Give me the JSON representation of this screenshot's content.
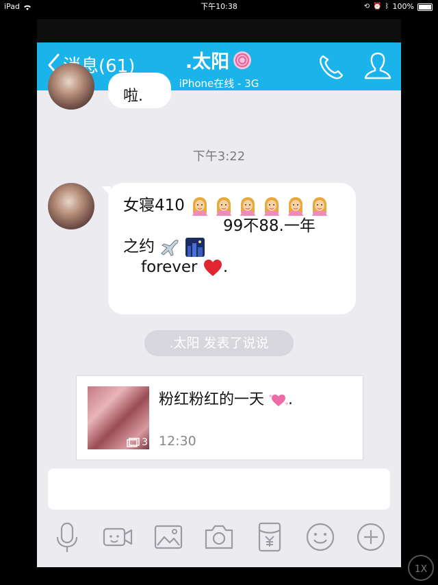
{
  "status_bar": {
    "device": "iPad",
    "time": "下午10:38",
    "battery": "100%"
  },
  "nav": {
    "back_label": "消息(61)",
    "title": ".太阳",
    "subtitle": "iPhone在线 - 3G"
  },
  "top_bubble_text": "啦.",
  "timestamp": "下午3:22",
  "message": {
    "line1": "女寝410",
    "line2": "99不88.一年",
    "line3": "之约",
    "line4": "forever",
    "line4_end": "."
  },
  "system_note": ".太阳 发表了说说",
  "shuoshuo_card": {
    "text": "粉红粉红的一天",
    "text_end": ".",
    "time": "12:30",
    "photo_count": "3"
  },
  "toolbar_icons": [
    "microphone-icon",
    "video-icon",
    "image-icon",
    "camera-icon",
    "red-packet-icon",
    "emoji-icon",
    "plus-icon"
  ],
  "zoom_label": "1X",
  "colors": {
    "nav": "#1ab3ea",
    "background": "#ececf0",
    "heart": "#e0262f"
  }
}
